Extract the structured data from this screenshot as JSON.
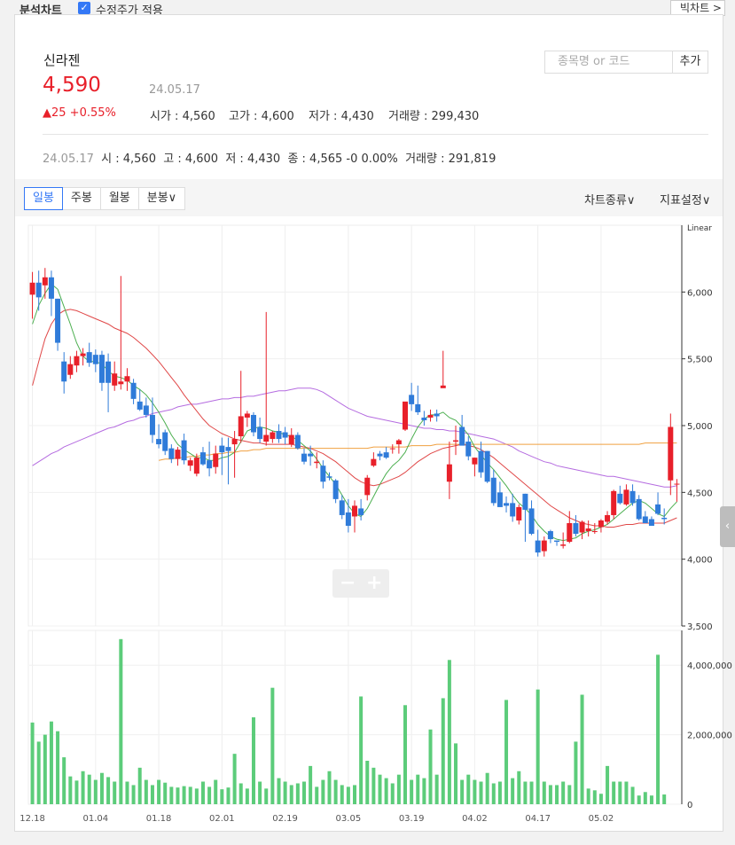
{
  "topbar": {
    "title": "분석차트",
    "adjusted_label": "수정주가 적용",
    "adjusted_checked": true,
    "bigchart_label": "빅차트 >"
  },
  "stock": {
    "name": "신라젠",
    "price": "4,590",
    "date": "24.05.17",
    "change": "▲25 +0.55%",
    "open": "시가 : 4,560",
    "high": "고가 : 4,600",
    "low": "저가 : 4,430",
    "volume": "거래량 : 299,430"
  },
  "search": {
    "placeholder": "종목명 or 코드",
    "add_label": "추가"
  },
  "ohlc_line": {
    "date": "24.05.17",
    "open": "시 : 4,560",
    "high": "고 : 4,600",
    "low": "저 : 4,430",
    "close": "종 : 4,565 -0 0.00%",
    "volume": "거래량 : 291,819"
  },
  "tabs": [
    {
      "label": "일봉",
      "active": true
    },
    {
      "label": "주봉"
    },
    {
      "label": "월봉"
    },
    {
      "label": "분봉∨"
    }
  ],
  "toolbar": {
    "chart_type": "차트종류∨",
    "indicators": "지표설정∨"
  },
  "colors": {
    "up": "#e8202a",
    "down": "#2f7bd9",
    "volume": "#5ccc7a",
    "ma5": "#4caf50",
    "ma20": "#e04848",
    "ma60": "#b56ce0",
    "ma120": "#f0a040"
  },
  "chart_data": {
    "type": "candlestick",
    "price_scale_label": "Linear",
    "price_ticks": [
      "6,000",
      "5,500",
      "5,000",
      "4,500",
      "4,000",
      "3,500"
    ],
    "price_tick_values": [
      6000,
      5500,
      5000,
      4500,
      4000,
      3500
    ],
    "ylim": [
      3500,
      6500
    ],
    "volume_ticks": [
      "4,000,000",
      "2,000,000",
      "0"
    ],
    "volume_tick_values": [
      4000000,
      2000000,
      0
    ],
    "volume_ylim": [
      0,
      5000000
    ],
    "x_tick_labels": [
      "12.18",
      "01.04",
      "01.18",
      "02.01",
      "02.19",
      "03.05",
      "03.19",
      "04.02",
      "04.17",
      "05.02"
    ],
    "x_tick_index": [
      0,
      10,
      20,
      30,
      40,
      50,
      60,
      70,
      80,
      90
    ],
    "candles": [
      [
        5980,
        6150,
        5800,
        6070
      ],
      [
        6070,
        6160,
        5860,
        5960
      ],
      [
        6050,
        6180,
        5950,
        6110
      ],
      [
        6110,
        6160,
        5820,
        5950
      ],
      [
        5950,
        5950,
        5560,
        5620
      ],
      [
        5480,
        5550,
        5240,
        5330
      ],
      [
        5380,
        5520,
        5350,
        5460
      ],
      [
        5450,
        5560,
        5400,
        5520
      ],
      [
        5520,
        5580,
        5450,
        5540
      ],
      [
        5550,
        5620,
        5440,
        5470
      ],
      [
        5530,
        5570,
        5400,
        5460
      ],
      [
        5530,
        5560,
        5260,
        5320
      ],
      [
        5480,
        5540,
        5100,
        5320
      ],
      [
        5300,
        5480,
        5260,
        5390
      ],
      [
        5310,
        6120,
        5270,
        5330
      ],
      [
        5330,
        5430,
        5260,
        5370
      ],
      [
        5320,
        5350,
        5160,
        5200
      ],
      [
        5180,
        5270,
        5110,
        5120
      ],
      [
        5150,
        5210,
        5060,
        5080
      ],
      [
        5080,
        5210,
        4870,
        4930
      ],
      [
        4900,
        5010,
        4830,
        4860
      ],
      [
        4950,
        4970,
        4780,
        4810
      ],
      [
        4830,
        4860,
        4720,
        4750
      ],
      [
        4750,
        4840,
        4700,
        4820
      ],
      [
        4890,
        4940,
        4710,
        4740
      ],
      [
        4700,
        4760,
        4660,
        4740
      ],
      [
        4640,
        4790,
        4620,
        4760
      ],
      [
        4800,
        4840,
        4700,
        4710
      ],
      [
        4740,
        4880,
        4620,
        4680
      ],
      [
        4690,
        4850,
        4640,
        4790
      ],
      [
        4850,
        4910,
        4630,
        4800
      ],
      [
        4840,
        4910,
        4560,
        4810
      ],
      [
        4860,
        4960,
        4610,
        4900
      ],
      [
        4920,
        5410,
        4870,
        5070
      ],
      [
        5060,
        5110,
        4990,
        5090
      ],
      [
        5080,
        5100,
        4920,
        4950
      ],
      [
        4990,
        5060,
        4870,
        4900
      ],
      [
        4880,
        5850,
        4850,
        4930
      ],
      [
        4900,
        4960,
        4870,
        4950
      ],
      [
        4960,
        5010,
        4870,
        4900
      ],
      [
        4950,
        4990,
        4860,
        4910
      ],
      [
        4860,
        4980,
        4840,
        4930
      ],
      [
        4930,
        4950,
        4820,
        4830
      ],
      [
        4790,
        4830,
        4710,
        4730
      ],
      [
        4790,
        4850,
        4700,
        4770
      ],
      [
        4720,
        4800,
        4680,
        4730
      ],
      [
        4700,
        4740,
        4530,
        4580
      ],
      [
        4620,
        4650,
        4590,
        4610
      ],
      [
        4590,
        4600,
        4420,
        4450
      ],
      [
        4440,
        4480,
        4300,
        4330
      ],
      [
        4350,
        4450,
        4200,
        4250
      ],
      [
        4320,
        4440,
        4200,
        4400
      ],
      [
        4380,
        4450,
        4290,
        4330
      ],
      [
        4480,
        4630,
        4440,
        4610
      ],
      [
        4700,
        4800,
        4690,
        4750
      ],
      [
        4790,
        4810,
        4740,
        4770
      ],
      [
        4800,
        4840,
        4750,
        4760
      ],
      [
        4830,
        4860,
        4790,
        4830
      ],
      [
        4860,
        4900,
        4790,
        4890
      ],
      [
        4970,
        5150,
        4960,
        5180
      ],
      [
        5230,
        5320,
        5110,
        5160
      ],
      [
        5160,
        5300,
        5080,
        5100
      ],
      [
        5060,
        5110,
        5000,
        5040
      ],
      [
        5060,
        5120,
        5030,
        5080
      ],
      [
        5090,
        5120,
        5030,
        5070
      ],
      [
        5280,
        5560,
        5290,
        5300
      ],
      [
        4580,
        4880,
        4450,
        4710
      ],
      [
        4880,
        5000,
        4780,
        4890
      ],
      [
        4990,
        5080,
        4860,
        4850
      ],
      [
        4880,
        4920,
        4740,
        4770
      ],
      [
        4710,
        4760,
        4620,
        4760
      ],
      [
        4810,
        4880,
        4610,
        4650
      ],
      [
        4810,
        4810,
        4570,
        4580
      ],
      [
        4610,
        4670,
        4400,
        4420
      ],
      [
        4500,
        4580,
        4390,
        4390
      ],
      [
        4420,
        4470,
        4350,
        4400
      ],
      [
        4420,
        4490,
        4280,
        4320
      ],
      [
        4290,
        4410,
        4260,
        4390
      ],
      [
        4490,
        4490,
        4130,
        4370
      ],
      [
        4380,
        4440,
        4180,
        4190
      ],
      [
        4140,
        4220,
        4020,
        4050
      ],
      [
        4060,
        4170,
        4020,
        4140
      ],
      [
        4210,
        4220,
        4120,
        4150
      ],
      [
        4140,
        4140,
        4100,
        4130
      ],
      [
        4100,
        4200,
        4080,
        4110
      ],
      [
        4130,
        4360,
        4120,
        4270
      ],
      [
        4270,
        4330,
        4170,
        4190
      ],
      [
        4200,
        4290,
        4150,
        4280
      ],
      [
        4210,
        4290,
        4170,
        4230
      ],
      [
        4210,
        4270,
        4190,
        4210
      ],
      [
        4240,
        4300,
        4200,
        4290
      ],
      [
        4280,
        4360,
        4260,
        4330
      ],
      [
        4330,
        4520,
        4300,
        4510
      ],
      [
        4490,
        4550,
        4410,
        4420
      ],
      [
        4410,
        4560,
        4400,
        4520
      ],
      [
        4510,
        4560,
        4400,
        4420
      ],
      [
        4450,
        4480,
        4290,
        4300
      ],
      [
        4320,
        4360,
        4270,
        4270
      ],
      [
        4300,
        4320,
        4250,
        4250
      ],
      [
        4410,
        4500,
        4330,
        4340
      ],
      [
        4310,
        4380,
        4260,
        4300
      ],
      [
        4590,
        5090,
        4480,
        4990
      ],
      [
        4560,
        4600,
        4430,
        4565
      ]
    ],
    "volume": [
      2350000,
      1800000,
      2000000,
      2380000,
      2100000,
      1350000,
      800000,
      680000,
      950000,
      850000,
      700000,
      900000,
      780000,
      650000,
      4750000,
      650000,
      550000,
      1050000,
      700000,
      550000,
      700000,
      620000,
      500000,
      480000,
      520000,
      500000,
      450000,
      650000,
      500000,
      700000,
      430000,
      480000,
      1450000,
      600000,
      450000,
      2500000,
      650000,
      450000,
      3350000,
      750000,
      650000,
      550000,
      600000,
      650000,
      1100000,
      500000,
      700000,
      950000,
      700000,
      550000,
      500000,
      550000,
      3100000,
      1250000,
      1050000,
      850000,
      750000,
      600000,
      850000,
      2850000,
      700000,
      850000,
      750000,
      2150000,
      850000,
      3050000,
      4150000,
      1750000,
      700000,
      850000,
      700000,
      650000,
      900000,
      600000,
      650000,
      3000000,
      750000,
      950000,
      650000,
      650000,
      3300000,
      650000,
      550000,
      550000,
      650000,
      550000,
      1800000,
      3150000,
      450000,
      400000,
      300000,
      1100000,
      650000,
      650000,
      650000,
      500000,
      250000,
      350000,
      250000,
      4300000,
      280000
    ],
    "ma5": [
      5760,
      5900,
      5990,
      6060,
      6020,
      5890,
      5760,
      5620,
      5520,
      5480,
      5480,
      5460,
      5410,
      5370,
      5360,
      5340,
      5300,
      5270,
      5230,
      5170,
      5100,
      5020,
      4930,
      4860,
      4820,
      4790,
      4760,
      4760,
      4740,
      4740,
      4760,
      4770,
      4800,
      4880,
      4960,
      4980,
      4990,
      4980,
      4960,
      4950,
      4930,
      4920,
      4890,
      4850,
      4810,
      4750,
      4680,
      4620,
      4560,
      4480,
      4400,
      4340,
      4320,
      4380,
      4470,
      4560,
      4640,
      4700,
      4740,
      4800,
      4900,
      4990,
      5050,
      5080,
      5080,
      5100,
      5060,
      5040,
      4990,
      4930,
      4840,
      4780,
      4720,
      4670,
      4610,
      4550,
      4480,
      4420,
      4380,
      4330,
      4260,
      4210,
      4170,
      4150,
      4140,
      4150,
      4160,
      4190,
      4210,
      4220,
      4240,
      4260,
      4300,
      4340,
      4380,
      4420,
      4440,
      4420,
      4380,
      4340,
      4320,
      4380,
      4430
    ],
    "ma20": [
      5300,
      5480,
      5650,
      5760,
      5830,
      5860,
      5870,
      5860,
      5840,
      5820,
      5800,
      5780,
      5760,
      5730,
      5710,
      5690,
      5660,
      5620,
      5580,
      5530,
      5480,
      5420,
      5360,
      5300,
      5230,
      5170,
      5110,
      5050,
      5000,
      4970,
      4940,
      4920,
      4900,
      4890,
      4880,
      4870,
      4870,
      4860,
      4860,
      4860,
      4860,
      4860,
      4850,
      4840,
      4830,
      4810,
      4790,
      4760,
      4730,
      4690,
      4650,
      4610,
      4580,
      4560,
      4550,
      4560,
      4580,
      4600,
      4620,
      4650,
      4690,
      4730,
      4760,
      4790,
      4810,
      4830,
      4840,
      4850,
      4860,
      4850,
      4840,
      4820,
      4790,
      4760,
      4720,
      4680,
      4640,
      4600,
      4560,
      4520,
      4480,
      4440,
      4400,
      4370,
      4340,
      4310,
      4290,
      4270,
      4260,
      4250,
      4250,
      4240,
      4240,
      4250,
      4260,
      4260,
      4270,
      4270,
      4270,
      4270,
      4270,
      4290,
      4310
    ],
    "ma60": [
      4700,
      4730,
      4760,
      4790,
      4810,
      4840,
      4860,
      4880,
      4900,
      4920,
      4940,
      4960,
      4980,
      4990,
      5010,
      5030,
      5040,
      5060,
      5070,
      5090,
      5100,
      5110,
      5120,
      5140,
      5150,
      5160,
      5160,
      5170,
      5180,
      5190,
      5200,
      5200,
      5210,
      5210,
      5220,
      5220,
      5230,
      5240,
      5250,
      5260,
      5260,
      5270,
      5280,
      5280,
      5280,
      5270,
      5250,
      5220,
      5190,
      5160,
      5130,
      5110,
      5090,
      5070,
      5060,
      5050,
      5040,
      5030,
      5020,
      5010,
      5000,
      4990,
      4980,
      4980,
      4970,
      4970,
      4960,
      4960,
      4950,
      4940,
      4930,
      4920,
      4910,
      4900,
      4880,
      4860,
      4840,
      4810,
      4790,
      4770,
      4750,
      4730,
      4720,
      4700,
      4690,
      4680,
      4670,
      4660,
      4650,
      4640,
      4630,
      4620,
      4620,
      4610,
      4600,
      4590,
      4580,
      4570,
      4560,
      4550,
      4540,
      4540,
      4550
    ],
    "ma120_start": 20,
    "ma120": [
      4740,
      4750,
      4750,
      4760,
      4760,
      4770,
      4770,
      4780,
      4780,
      4790,
      4790,
      4800,
      4800,
      4810,
      4810,
      4820,
      4820,
      4830,
      4830,
      4830,
      4830,
      4830,
      4830,
      4830,
      4830,
      4830,
      4830,
      4830,
      4830,
      4830,
      4830,
      4830,
      4830,
      4830,
      4840,
      4840,
      4840,
      4840,
      4840,
      4840,
      4850,
      4850,
      4850,
      4850,
      4860,
      4860,
      4860,
      4860,
      4860,
      4860,
      4860,
      4860,
      4860,
      4860,
      4860,
      4860,
      4860,
      4860,
      4860,
      4860,
      4860,
      4860,
      4860,
      4860,
      4860,
      4860,
      4860,
      4860,
      4860,
      4860,
      4860,
      4860,
      4860,
      4860,
      4860,
      4860,
      4860,
      4870,
      4870,
      4870,
      4870,
      4870,
      4870
    ]
  }
}
